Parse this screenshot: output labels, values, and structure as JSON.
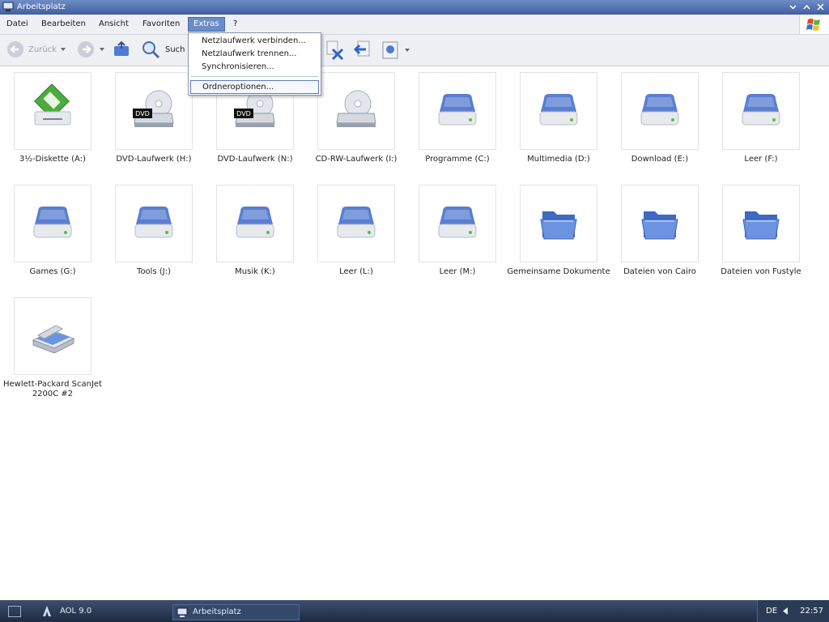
{
  "window": {
    "title": "Arbeitsplatz"
  },
  "menu": {
    "items": [
      "Datei",
      "Bearbeiten",
      "Ansicht",
      "Favoriten",
      "Extras",
      "?"
    ],
    "active": "Extras"
  },
  "extras_menu": {
    "items": [
      "Netzlaufwerk verbinden...",
      "Netzlaufwerk trennen...",
      "Synchronisieren...",
      "Ordneroptionen..."
    ],
    "selected": "Ordneroptionen..."
  },
  "toolbar": {
    "back_label": "Zurück",
    "search_label": "Such"
  },
  "items": [
    {
      "label": "3½-Diskette (A:)",
      "icon": "floppy-drive-icon"
    },
    {
      "label": "DVD-Laufwerk (H:)",
      "icon": "dvd-drive-icon"
    },
    {
      "label": "DVD-Laufwerk (N:)",
      "icon": "dvd-drive-icon"
    },
    {
      "label": "CD-RW-Laufwerk (I:)",
      "icon": "cd-drive-icon"
    },
    {
      "label": "Programme (C:)",
      "icon": "hard-drive-icon"
    },
    {
      "label": "Multimedia (D:)",
      "icon": "hard-drive-icon"
    },
    {
      "label": "Download (E:)",
      "icon": "hard-drive-icon"
    },
    {
      "label": "Leer (F:)",
      "icon": "hard-drive-icon"
    },
    {
      "label": "Games (G:)",
      "icon": "hard-drive-icon"
    },
    {
      "label": "Tools (J:)",
      "icon": "hard-drive-icon"
    },
    {
      "label": "Musik (K:)",
      "icon": "hard-drive-icon"
    },
    {
      "label": "Leer (L:)",
      "icon": "hard-drive-icon"
    },
    {
      "label": "Leer (M:)",
      "icon": "hard-drive-icon"
    },
    {
      "label": "Gemeinsame Dokumente",
      "icon": "folder-icon"
    },
    {
      "label": "Dateien von Cairo",
      "icon": "folder-icon"
    },
    {
      "label": "Dateien von Fustyle",
      "icon": "folder-icon"
    },
    {
      "label": "Hewlett-Packard ScanJet 2200C #2",
      "icon": "scanner-icon"
    }
  ],
  "taskbar": {
    "tasks": [
      "AOL 9.0",
      "Arbeitsplatz"
    ],
    "language": "DE",
    "clock": "22:57"
  },
  "colors": {
    "titlebar": "#4f6fae",
    "menu_active": "#6b8ccb",
    "drive_blue": "#5a7fd0",
    "taskbar": "#2a3a56"
  }
}
